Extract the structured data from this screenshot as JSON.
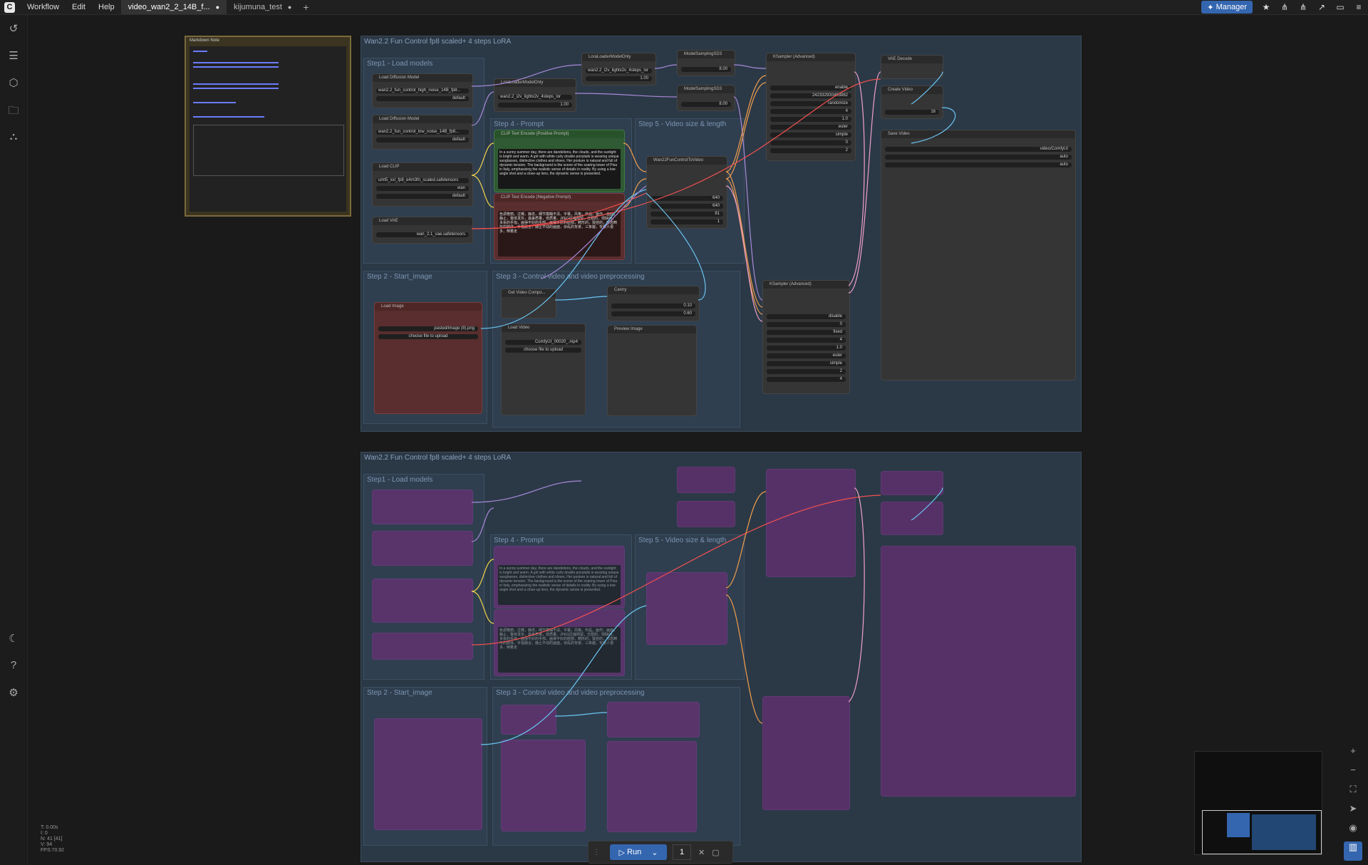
{
  "topbar": {
    "menu": [
      "Workflow",
      "Edit",
      "Help"
    ],
    "tabs": [
      {
        "label": "video_wan2_2_14B_f...",
        "active": true
      },
      {
        "label": "kijumuna_test",
        "active": false
      }
    ],
    "manager_label": "Manager"
  },
  "workflow_a": {
    "title": "Wan2.2 Fun Control fp8 scaled+ 4 steps LoRA",
    "steps": {
      "step1": "Step1 - Load models",
      "step2": "Step 2 - Start_image",
      "step3": "Step 3 - Control video and video preprocessing",
      "step4": "Step 4 - Prompt",
      "step5": "Step 5 - Video size & length"
    },
    "nodes": {
      "load_diffusion_1": {
        "title": "Load Diffusion Model",
        "value": "wan2.2_fun_control_high_noise_14B_fp8...",
        "dtype": "default"
      },
      "load_diffusion_2": {
        "title": "Load Diffusion Model",
        "value": "wan2.2_fun_control_low_noise_14B_fp8...",
        "dtype": "default"
      },
      "load_clip": {
        "title": "Load CLIP",
        "value": "umt5_xxl_fp8_e4m3fn_scaled.safetensors",
        "type": "wan",
        "device": "default"
      },
      "load_vae": {
        "title": "Load VAE",
        "value": "wan_2.1_vae.safetensors"
      },
      "lora_1": {
        "title": "LoraLoaderModelOnly",
        "value": "wan2.2_i2v_lightx2v_4steps_lor",
        "strength": "1.00"
      },
      "lora_2": {
        "title": "LoraLoaderModelOnly",
        "value": "wan2.2_i2v_lightx2v_4steps_lor",
        "strength": "1.00"
      },
      "msd3_1": {
        "title": "ModelSamplingSD3",
        "shift": "8.00"
      },
      "msd3_2": {
        "title": "ModelSamplingSD3",
        "shift": "8.00"
      },
      "pos_prompt": {
        "title": "CLIP Text Encode (Positive Prompt)",
        "text": "In a sunny summer day, there are dandelions, the clouds, and the sunlight is bright and warm. A girl with white curly double ponytails is wearing unique sunglasses, distinctive clothes and shoes. Her posture is natural and full of dynamic tension. The background is the scene of the soaring tower of Pisa in Italy, emphasizing the realistic sense of details in reality. By using a low-angle shot and a close-up lens, the dynamic sense is presented."
      },
      "neg_prompt": {
        "title": "CLIP Text Encode (Negative Prompt)",
        "text": "色调艳丽，过曝，静态，细节模糊不清，字幕，风格，作品，画作，画面，静止，整体发灰，最差质量，低质量，JPEG压缩残留，丑陋的，残缺的，多余的手指，画得不好的手部，画得不好的脸部，畸形的，毁容的，形态畸形的肢体，手指融合，静止不动的画面，杂乱的背景，三条腿，背景人很多，倒着走"
      },
      "wan_fun": {
        "title": "Wan22FunControlToVideo",
        "width": "640",
        "height": "640",
        "length": "81",
        "batch_size": "1"
      },
      "ksampler_1": {
        "title": "KSampler (Advanced)",
        "add_noise": "enable",
        "noise_seed": "242332930403882",
        "control": "randomize",
        "steps": "4",
        "cfg": "1.0",
        "sampler": "euler",
        "scheduler": "simple",
        "start": "0",
        "end": "2",
        "leftover": "enable"
      },
      "ksampler_2": {
        "title": "KSampler (Advanced)",
        "add_noise": "disable",
        "noise_seed": "0",
        "control": "fixed",
        "steps": "4",
        "cfg": "1.0",
        "sampler": "euler",
        "scheduler": "simple",
        "start": "2",
        "end": "4",
        "leftover": "disable"
      },
      "vae_decode": {
        "title": "VAE Decode"
      },
      "create_video": {
        "title": "Create Video",
        "fps": "16"
      },
      "save_video": {
        "title": "Save Video",
        "prefix": "video/ComfyUI",
        "format": "auto",
        "codec": "auto"
      },
      "load_image": {
        "title": "Load Image",
        "value": "pasted/image (8).png",
        "upload": "choose file to upload"
      },
      "get_video": {
        "title": "Get Video Compo..."
      },
      "load_video": {
        "title": "Load Video",
        "value": "ComfyUI_00020_.mp4",
        "upload": "choose file to upload"
      },
      "canny": {
        "title": "Canny",
        "low": "0.10",
        "high": "0.60"
      },
      "preview": {
        "title": "Preview Image"
      }
    }
  },
  "workflow_b": {
    "title": "Wan2.2 Fun Control fp8 scaled+ 4 steps LoRA",
    "steps": {
      "step1": "Step1 - Load models",
      "step2": "Step 2 - Start_image",
      "step3": "Step 3 - Control video and video preprocessing",
      "step4": "Step 4 - Prompt",
      "step5": "Step 5 - Video size & length"
    }
  },
  "markdown_note": {
    "title": "Markdown Note"
  },
  "run": {
    "label": "Run",
    "count": "1"
  },
  "stats": [
    "T: 0.00s",
    "I: 0",
    "N: 41 [41]",
    "V: 94",
    "FPS:70.92"
  ],
  "colors": {
    "accent": "#3466b0",
    "group": "#2b3947",
    "purple_node": "#7a2c82"
  }
}
